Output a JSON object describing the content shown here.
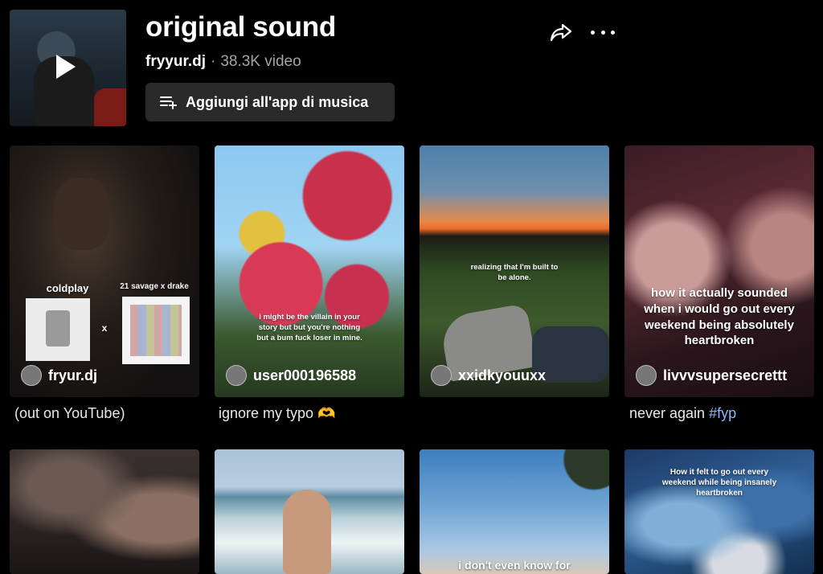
{
  "header": {
    "title": "original sound",
    "author": "fryyur.dj",
    "separator": "·",
    "video_count": "38.3K video",
    "add_button_label": "Aggiungi all'app di musica"
  },
  "videos": [
    {
      "author": "fryur.dj",
      "caption": "(out on YouTube)",
      "overlay": {
        "left_label": "coldplay",
        "right_label": "21 savage x drake",
        "x": "x"
      }
    },
    {
      "author": "user000196588",
      "caption": "ignore my typo 🫶",
      "overlay": {
        "text": "i might be the villain in your story but but you're nothing but a bum fuck loser in mine."
      }
    },
    {
      "author": "xxidkyouuxx",
      "caption": "",
      "overlay": {
        "text": "realizing that I'm built to be alone."
      }
    },
    {
      "author": "livvvsupersecrettt",
      "caption_text": "never again ",
      "caption_tag": "#fyp",
      "overlay": {
        "text": "how it actually sounded when i would go out every weekend being absolutely heartbroken"
      }
    },
    {
      "overlay": {
        "text": ""
      }
    },
    {
      "overlay": {
        "text": ""
      }
    },
    {
      "overlay": {
        "text": "i don't even know for"
      }
    },
    {
      "overlay": {
        "text": "How it felt to go out every weekend while being insanely heartbroken"
      }
    }
  ]
}
